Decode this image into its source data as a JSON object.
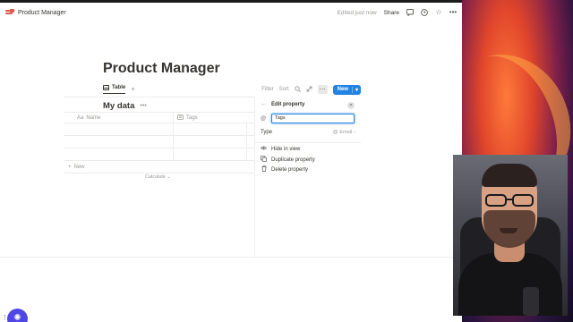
{
  "topbar": {
    "breadcrumb": "Product Manager",
    "edited": "Edited just now",
    "share": "Share"
  },
  "page": {
    "title": "Product Manager"
  },
  "viewbar": {
    "tab_label": "Table",
    "add_view": "+",
    "filter": "Filter",
    "sort": "Sort",
    "new_label": "New"
  },
  "database": {
    "title": "My data",
    "columns": [
      {
        "icon": "Aa",
        "label": "Name"
      },
      {
        "icon": "tags-icon",
        "label": "Tags"
      }
    ],
    "rows": 3,
    "new_row": "New",
    "calculate": "Calculate"
  },
  "panel": {
    "title": "Edit property",
    "name_value": "Tags",
    "type_label": "Type",
    "type_value": "Email",
    "actions": [
      {
        "icon": "eye-icon",
        "label": "Hide in view"
      },
      {
        "icon": "duplicate-icon",
        "label": "Duplicate property"
      },
      {
        "icon": "trash-icon",
        "label": "Delete property"
      }
    ]
  },
  "colors": {
    "accent": "#2383e2",
    "text": "#37352f",
    "muted": "#9b9a97",
    "brand_icon": "#e0564a"
  }
}
